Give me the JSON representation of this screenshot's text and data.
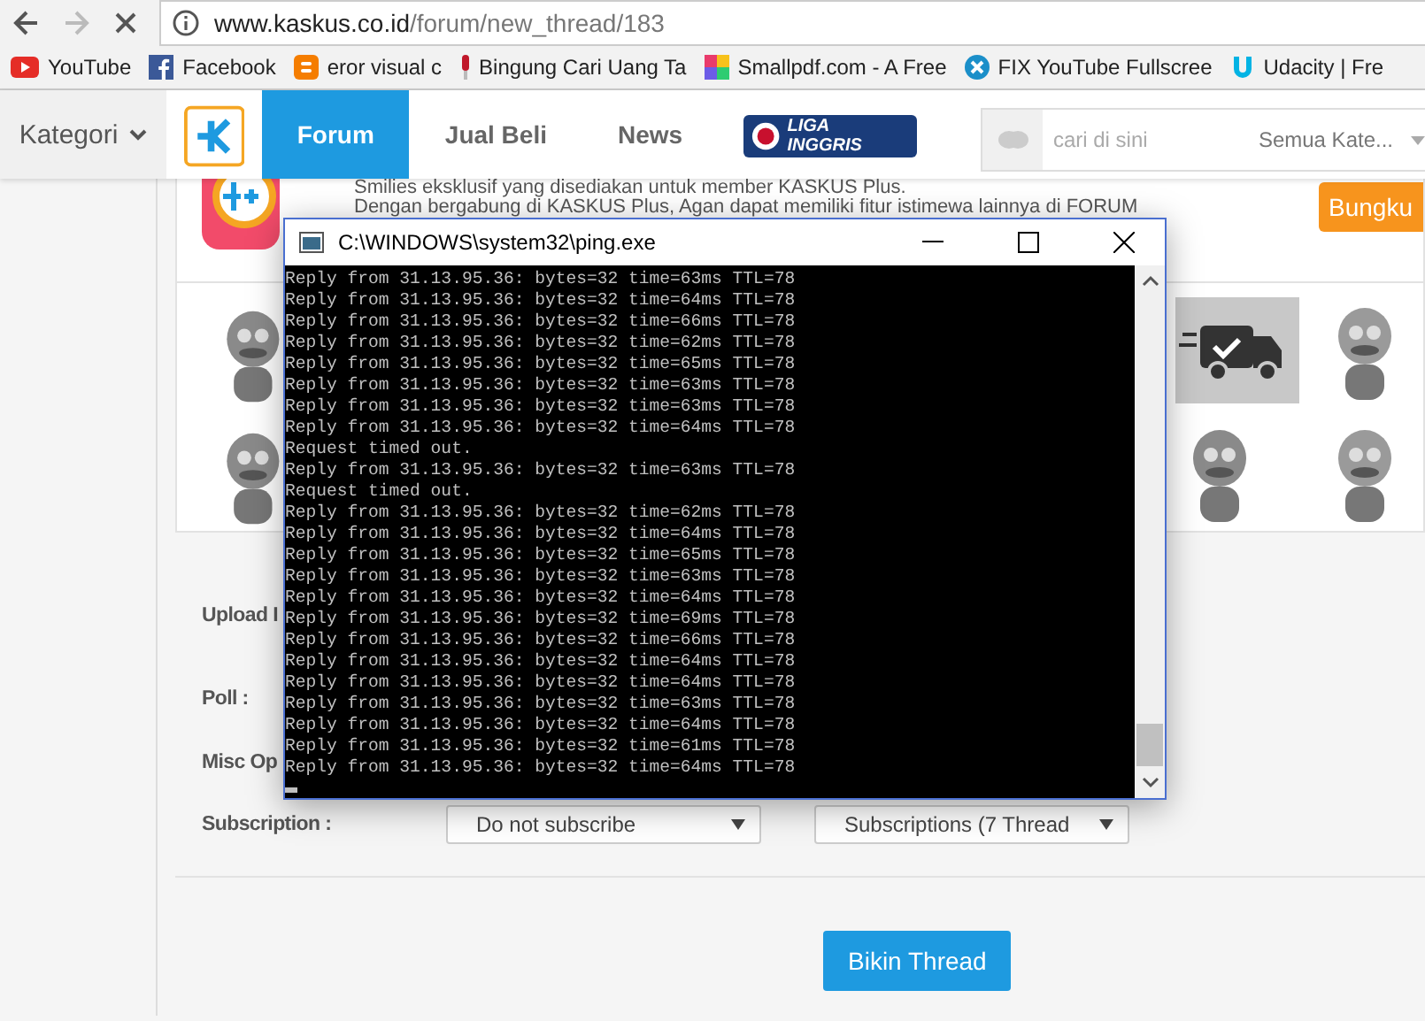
{
  "browser": {
    "url_host": "www.kaskus.co.id",
    "url_path": "/forum/new_thread/183"
  },
  "bookmarks": [
    {
      "label": "YouTube"
    },
    {
      "label": "Facebook"
    },
    {
      "label": "eror visual c"
    },
    {
      "label": "Bingung Cari Uang Ta"
    },
    {
      "label": "Smallpdf.com - A Free"
    },
    {
      "label": "FIX YouTube Fullscree"
    },
    {
      "label": "Udacity | Fre"
    }
  ],
  "site_nav": {
    "category_label": "Kategori",
    "tabs": [
      {
        "label": "Forum",
        "selected": true
      },
      {
        "label": "Jual Beli",
        "selected": false
      },
      {
        "label": "News",
        "selected": false
      }
    ],
    "league_logo": "LIGA INGGRIS",
    "search": {
      "placeholder": "cari di sini"
    },
    "search_scope": "Semua Kate..."
  },
  "promo": {
    "lines": [
      "Smilies eksklusif yang disediakan untuk member KASKUS Plus.",
      "Dengan bergabung di KASKUS Plus, Agan dapat memiliki fitur istimewa lainnya di FORUM"
    ],
    "button": "Bungku"
  },
  "form": {
    "rows": [
      {
        "label": "Upload I"
      },
      {
        "label": "Poll :"
      },
      {
        "label": "Misc Op"
      },
      {
        "label": "Subscription :"
      }
    ],
    "selects": [
      "Do not subscribe",
      "Subscriptions (7 Thread"
    ],
    "submit": "Bikin Thread"
  },
  "console": {
    "title": "C:\\WINDOWS\\system32\\ping.exe",
    "lines": [
      "Reply from 31.13.95.36: bytes=32 time=63ms TTL=78",
      "Reply from 31.13.95.36: bytes=32 time=64ms TTL=78",
      "Reply from 31.13.95.36: bytes=32 time=66ms TTL=78",
      "Reply from 31.13.95.36: bytes=32 time=62ms TTL=78",
      "Reply from 31.13.95.36: bytes=32 time=65ms TTL=78",
      "Reply from 31.13.95.36: bytes=32 time=63ms TTL=78",
      "Reply from 31.13.95.36: bytes=32 time=63ms TTL=78",
      "Reply from 31.13.95.36: bytes=32 time=64ms TTL=78",
      "Request timed out.",
      "Reply from 31.13.95.36: bytes=32 time=63ms TTL=78",
      "Request timed out.",
      "Reply from 31.13.95.36: bytes=32 time=62ms TTL=78",
      "Reply from 31.13.95.36: bytes=32 time=64ms TTL=78",
      "Reply from 31.13.95.36: bytes=32 time=65ms TTL=78",
      "Reply from 31.13.95.36: bytes=32 time=63ms TTL=78",
      "Reply from 31.13.95.36: bytes=32 time=64ms TTL=78",
      "Reply from 31.13.95.36: bytes=32 time=69ms TTL=78",
      "Reply from 31.13.95.36: bytes=32 time=66ms TTL=78",
      "Reply from 31.13.95.36: bytes=32 time=64ms TTL=78",
      "Reply from 31.13.95.36: bytes=32 time=64ms TTL=78",
      "Reply from 31.13.95.36: bytes=32 time=63ms TTL=78",
      "Reply from 31.13.95.36: bytes=32 time=64ms TTL=78",
      "Reply from 31.13.95.36: bytes=32 time=61ms TTL=78",
      "Reply from 31.13.95.36: bytes=32 time=64ms TTL=78"
    ]
  }
}
